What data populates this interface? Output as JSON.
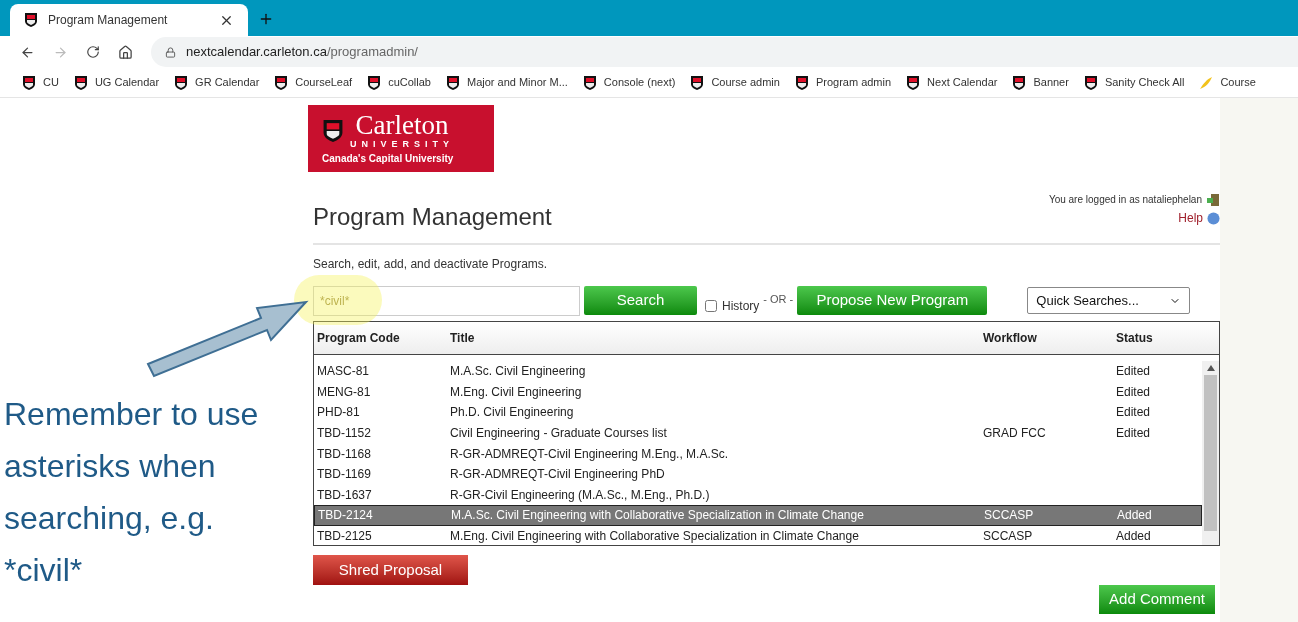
{
  "browser": {
    "tab": {
      "title": "Program Management",
      "selected": true
    },
    "url": {
      "host": "nextcalendar.carleton.ca",
      "path": "/programadmin/"
    },
    "bookmarks": [
      {
        "label": "CU",
        "kind": "shield"
      },
      {
        "label": "UG Calendar",
        "kind": "shield"
      },
      {
        "label": "GR Calendar",
        "kind": "shield"
      },
      {
        "label": "CourseLeaf",
        "kind": "shield"
      },
      {
        "label": "cuCollab",
        "kind": "shield"
      },
      {
        "label": "Major and Minor M...",
        "kind": "shield"
      },
      {
        "label": "Console (next)",
        "kind": "shield"
      },
      {
        "label": "Course admin",
        "kind": "shield"
      },
      {
        "label": "Program admin",
        "kind": "shield"
      },
      {
        "label": "Next Calendar",
        "kind": "shield"
      },
      {
        "label": "Banner",
        "kind": "shield"
      },
      {
        "label": "Sanity Check All",
        "kind": "shield"
      },
      {
        "label": "Course",
        "kind": "leaf"
      }
    ]
  },
  "page": {
    "logo": {
      "name": "Carleton",
      "sub": "UNIVERSITY",
      "tagline": "Canada's Capital University"
    },
    "title": "Program Management",
    "login": {
      "text": "You are logged in as nataliephelan",
      "help": "Help"
    },
    "description": "Search, edit, add, and deactivate Programs.",
    "search": {
      "value": "*civil*",
      "button": "Search"
    },
    "history": {
      "label": "History",
      "checked": false
    },
    "or_text": "- OR -",
    "propose": "Propose New Program",
    "quick_searches": "Quick Searches...",
    "table": {
      "columns": [
        "Program Code",
        "Title",
        "Workflow",
        "Status"
      ],
      "rows": [
        {
          "code": "MASC-81",
          "title": "M.A.Sc. Civil Engineering",
          "workflow": "",
          "status": "Edited",
          "selected": false
        },
        {
          "code": "MENG-81",
          "title": "M.Eng. Civil Engineering",
          "workflow": "",
          "status": "Edited",
          "selected": false
        },
        {
          "code": "PHD-81",
          "title": "Ph.D. Civil Engineering",
          "workflow": "",
          "status": "Edited",
          "selected": false
        },
        {
          "code": "TBD-1152",
          "title": "Civil Engineering - Graduate Courses list",
          "workflow": "GRAD FCC",
          "status": "Edited",
          "selected": false
        },
        {
          "code": "TBD-1168",
          "title": "R-GR-ADMREQT-Civil Engineering M.Eng., M.A.Sc.",
          "workflow": "",
          "status": "",
          "selected": false
        },
        {
          "code": "TBD-1169",
          "title": "R-GR-ADMREQT-Civil Engineering PhD",
          "workflow": "",
          "status": "",
          "selected": false
        },
        {
          "code": "TBD-1637",
          "title": "R-GR-Civil Engineering (M.A.Sc., M.Eng., Ph.D.)",
          "workflow": "",
          "status": "",
          "selected": false
        },
        {
          "code": "TBD-2124",
          "title": "M.A.Sc. Civil Engineering with Collaborative Specialization in Climate Change",
          "workflow": "SCCASP",
          "status": "Added",
          "selected": true
        },
        {
          "code": "TBD-2125",
          "title": "M.Eng. Civil Engineering with Collaborative Specialization in Climate Change",
          "workflow": "SCCASP",
          "status": "Added",
          "selected": false
        }
      ]
    },
    "shred": "Shred Proposal",
    "add_comment": "Add Comment"
  },
  "annotation": {
    "text": "Remember to use asterisks when searching, e.g. *civil*"
  }
}
